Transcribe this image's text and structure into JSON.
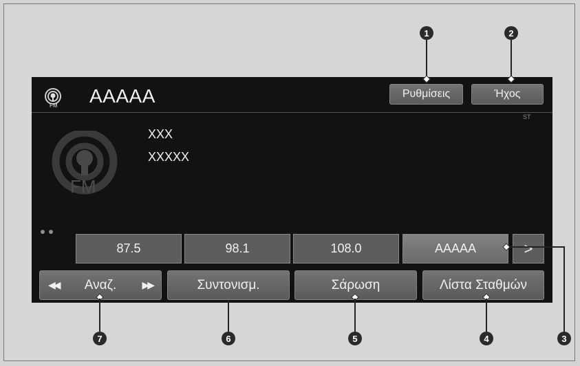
{
  "header": {
    "station_name": "AAAAA",
    "settings_label": "Ρυθμίσεις",
    "sound_label": "Ήχος",
    "band_icon_text": "FM"
  },
  "info": {
    "line1": "XXX",
    "line2": "XXXXX",
    "stereo_indicator": "ST",
    "big_icon_text": "FM"
  },
  "presets": {
    "items": [
      "87.5",
      "98.1",
      "108.0",
      "AAAAA"
    ],
    "next_label": ">"
  },
  "bottom": {
    "seek_label": "Αναζ.",
    "tune_label": "Συντονισμ.",
    "scan_label": "Σάρωση",
    "station_list_label": "Λίστα Σταθμών"
  },
  "callouts": [
    "1",
    "2",
    "3",
    "4",
    "5",
    "6",
    "7"
  ]
}
